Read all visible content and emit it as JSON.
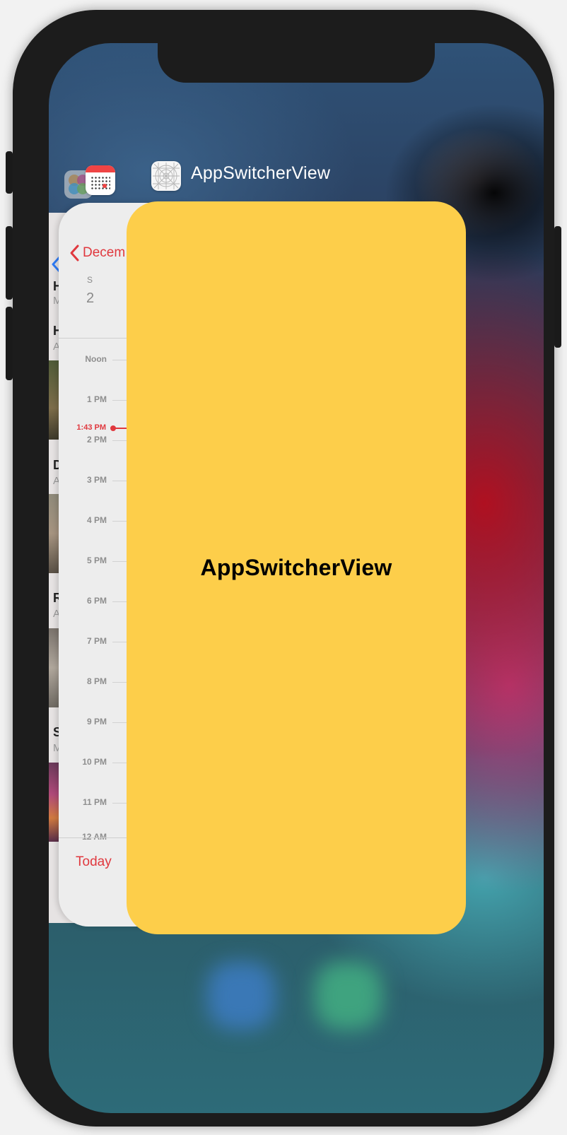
{
  "switcher": {
    "app_name": "AppSwitcherView",
    "card_label": "AppSwitcherView",
    "card_color": "#fdce4a"
  },
  "photos_card": {
    "fragments": [
      "H",
      "M",
      "H",
      "A",
      "D",
      "A",
      "R",
      "A",
      "S",
      "M"
    ]
  },
  "calendar_card": {
    "back_label": "Decem",
    "weekday": "S",
    "day": "2",
    "hours": [
      "Noon",
      "1 PM",
      "2 PM",
      "3 PM",
      "4 PM",
      "5 PM",
      "6 PM",
      "7 PM",
      "8 PM",
      "9 PM",
      "10 PM",
      "11 PM",
      "12 AM"
    ],
    "current_time": "1:43 PM",
    "today_label": "Today",
    "accent_color": "#e0383e"
  },
  "icons": {
    "photos": "photos-app-icon",
    "calendar": "calendar-app-icon",
    "app": "appswitcherview-app-icon"
  }
}
